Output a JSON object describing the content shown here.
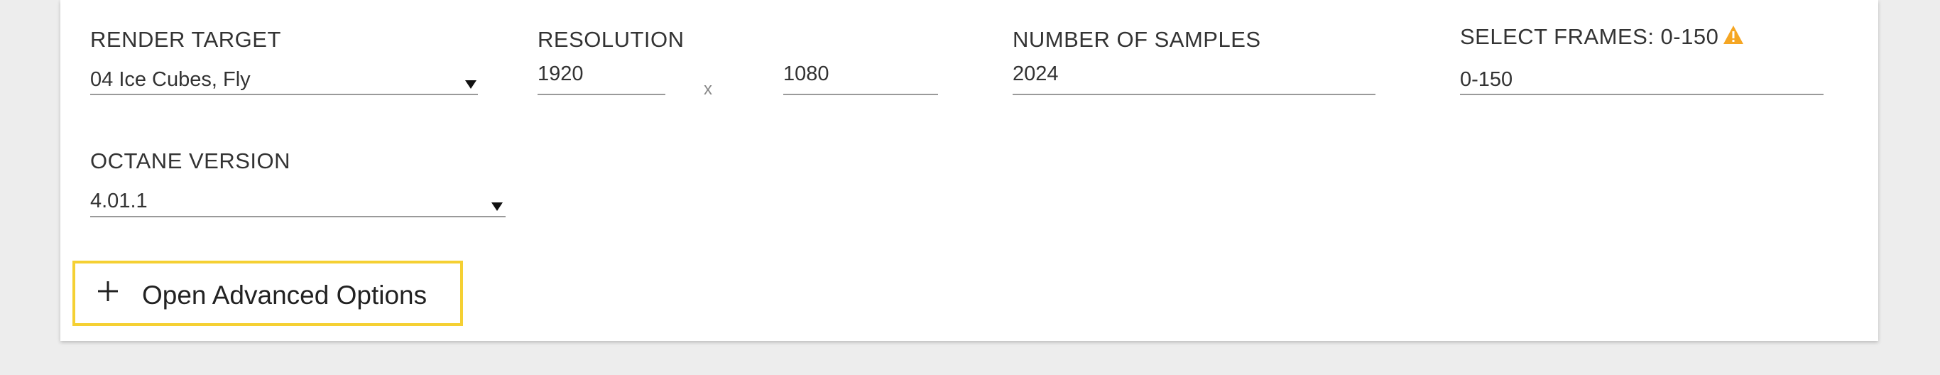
{
  "render_target": {
    "label": "RENDER TARGET",
    "value": "04 Ice Cubes, Fly"
  },
  "resolution": {
    "label": "RESOLUTION",
    "width": "1920",
    "separator": "x",
    "height": "1080"
  },
  "samples": {
    "label": "NUMBER OF SAMPLES",
    "value": "2024"
  },
  "frames": {
    "label": "SELECT FRAMES: 0-150",
    "value": "0-150",
    "warning_icon": "warning-icon",
    "warning_color": "#f5a623"
  },
  "octane": {
    "label": "OCTANE VERSION",
    "value": "4.01.1"
  },
  "advanced": {
    "label": "Open Advanced Options",
    "icon": "plus-icon",
    "border_color": "#f5d033"
  }
}
